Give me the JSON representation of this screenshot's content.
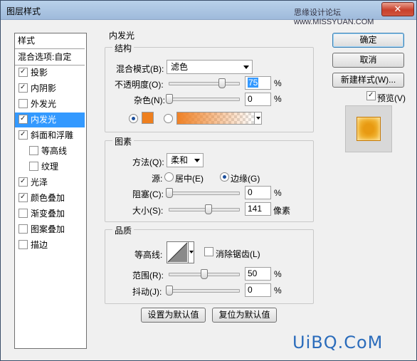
{
  "window": {
    "title": "图层样式",
    "watermark": "思缘设计论坛 www.MISSYUAN.COM",
    "close_label": "✕"
  },
  "left_list": {
    "header": "样式",
    "blend_options": "混合选项:自定",
    "items": [
      {
        "label": "投影",
        "checked": true,
        "indent": false,
        "selected": false
      },
      {
        "label": "内阴影",
        "checked": true,
        "indent": false,
        "selected": false
      },
      {
        "label": "外发光",
        "checked": false,
        "indent": false,
        "selected": false
      },
      {
        "label": "内发光",
        "checked": true,
        "indent": false,
        "selected": true
      },
      {
        "label": "斜面和浮雕",
        "checked": true,
        "indent": false,
        "selected": false
      },
      {
        "label": "等高线",
        "checked": false,
        "indent": true,
        "selected": false
      },
      {
        "label": "纹理",
        "checked": false,
        "indent": true,
        "selected": false
      },
      {
        "label": "光泽",
        "checked": true,
        "indent": false,
        "selected": false
      },
      {
        "label": "颜色叠加",
        "checked": true,
        "indent": false,
        "selected": false
      },
      {
        "label": "渐变叠加",
        "checked": false,
        "indent": false,
        "selected": false
      },
      {
        "label": "图案叠加",
        "checked": false,
        "indent": false,
        "selected": false
      },
      {
        "label": "描边",
        "checked": false,
        "indent": false,
        "selected": false
      }
    ]
  },
  "section_title": "内发光",
  "structure": {
    "title": "结构",
    "blend_mode_label": "混合模式(B):",
    "blend_mode_value": "滤色",
    "opacity_label": "不透明度(O):",
    "opacity_value": "75",
    "opacity_level": 75,
    "noise_label": "杂色(N):",
    "noise_value": "0",
    "noise_level": 0,
    "percent": "%",
    "color": "#ee7f1e"
  },
  "elements": {
    "title": "图素",
    "technique_label": "方法(Q):",
    "technique_value": "柔和",
    "source_label": "源:",
    "source_center": "居中(E)",
    "source_edge": "边缘(G)",
    "choke_label": "阻塞(C):",
    "choke_value": "0",
    "choke_level": 0,
    "size_label": "大小(S):",
    "size_value": "141",
    "size_level": 141,
    "size_max": 250,
    "size_unit": "像素",
    "percent": "%"
  },
  "quality": {
    "title": "品质",
    "contour_label": "等高线:",
    "anti_alias_label": "消除锯齿(L)",
    "anti_alias_checked": false,
    "range_label": "范围(R):",
    "range_value": "50",
    "range_level": 50,
    "jitter_label": "抖动(J):",
    "jitter_value": "0",
    "jitter_level": 0,
    "percent": "%"
  },
  "bottom_buttons": {
    "make_default": "设置为默认值",
    "reset_default": "复位为默认值"
  },
  "right_buttons": {
    "ok": "确定",
    "cancel": "取消",
    "new_style": "新建样式(W)...",
    "preview_label": "预览(V)",
    "preview_checked": true
  },
  "footer_logo": "UiBQ.CoM"
}
